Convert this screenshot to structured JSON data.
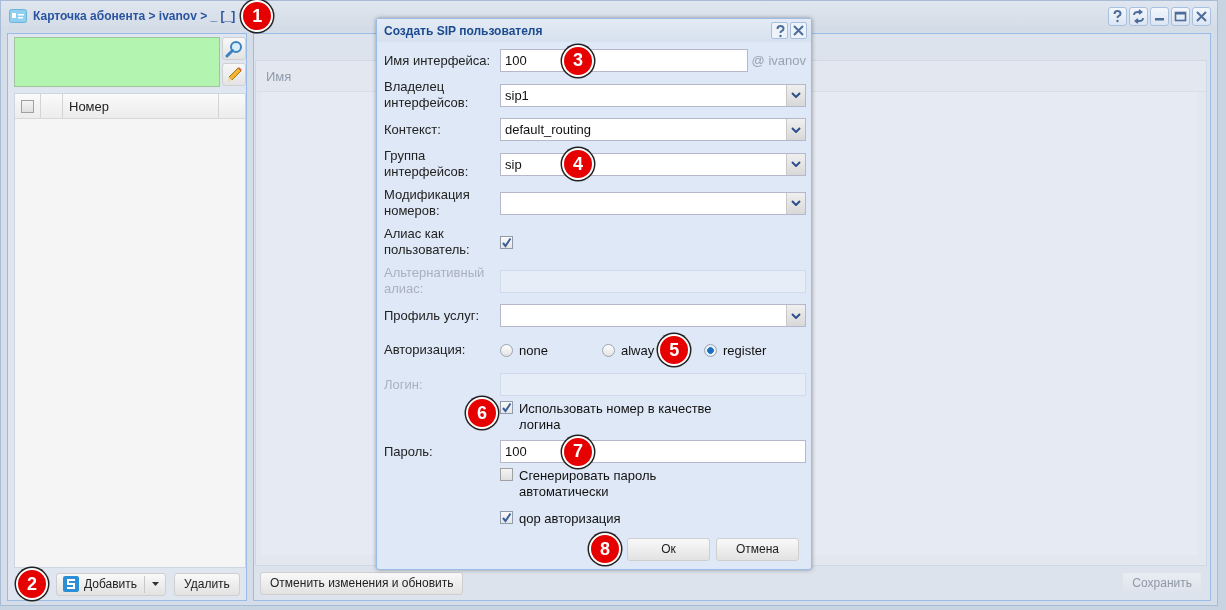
{
  "window": {
    "title": "Карточка абонента > ivanov > _ [_]",
    "callout": "1",
    "tools": [
      {
        "kind": "help"
      },
      {
        "kind": "refresh"
      },
      {
        "kind": "minimize"
      },
      {
        "kind": "maximize"
      },
      {
        "kind": "close"
      }
    ]
  },
  "left_panel": {
    "grid": {
      "select_all_checked": false,
      "columns": [
        "Номер"
      ]
    },
    "toolbar": {
      "callout": "2",
      "add_button": "Добавить",
      "delete_button": "Удалить"
    }
  },
  "right_panel": {
    "columns": [
      "Имя"
    ],
    "revert_button": "Отменить изменения и обновить",
    "save_button": {
      "label": "Сохранить",
      "disabled": true
    }
  },
  "dialog": {
    "title": "Создать SIP пользователя",
    "fields": [
      {
        "kind": "text",
        "label": "Имя интерфейса:",
        "value": "100",
        "suffix": "@ ivanov",
        "callout": "3"
      },
      {
        "kind": "select",
        "label": "Владелец интерфейсов:",
        "value": "sip1"
      },
      {
        "kind": "select",
        "label": "Контекст:",
        "value": "default_routing"
      },
      {
        "kind": "select",
        "label": "Группа интерфейсов:",
        "value": "sip",
        "callout": "4"
      },
      {
        "kind": "select",
        "label": "Модификация номеров:"
      },
      {
        "kind": "checkbox",
        "label": "Алиас как пользователь:",
        "checked": true
      },
      {
        "kind": "text",
        "label": "Альтернативный алиас:",
        "disabled": true
      },
      {
        "kind": "select",
        "label": "Профиль услуг:"
      },
      {
        "kind": "radio",
        "label": "Авторизация:",
        "callout": "5",
        "options": [
          {
            "label": "none",
            "selected": false
          },
          {
            "label": "alway",
            "selected": false
          },
          {
            "label": "register",
            "selected": true
          }
        ]
      },
      {
        "kind": "text",
        "label": "Логин:",
        "disabled": true
      },
      {
        "kind": "option",
        "text": "Использовать номер в качестве логина",
        "checked": true,
        "callout": "6"
      },
      {
        "kind": "text",
        "label": "Пароль:",
        "value": "100",
        "callout": "7"
      },
      {
        "kind": "option",
        "text": "Сгенерировать пароль автоматически",
        "checked": false
      },
      {
        "kind": "option",
        "text": "qop авторизация",
        "checked": true
      }
    ],
    "buttons_callout": "8",
    "buttons": [
      "Ок",
      "Отмена"
    ]
  }
}
